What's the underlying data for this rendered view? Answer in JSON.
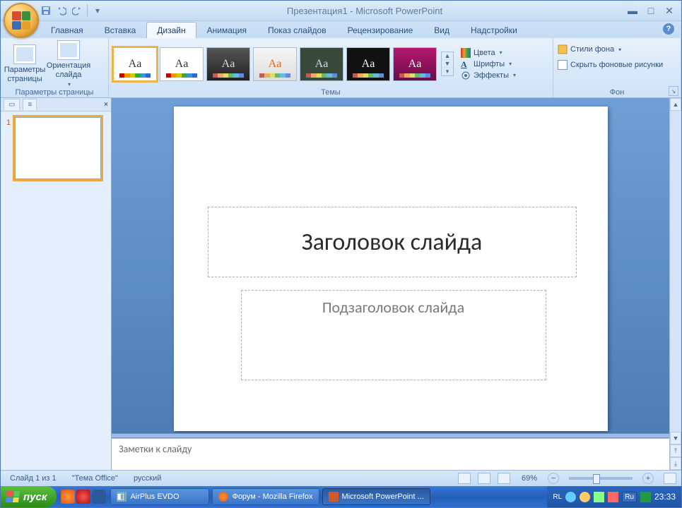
{
  "window": {
    "title": "Презентация1 - Microsoft PowerPoint"
  },
  "tabs": {
    "items": [
      "Главная",
      "Вставка",
      "Дизайн",
      "Анимация",
      "Показ слайдов",
      "Рецензирование",
      "Вид",
      "Надстройки"
    ],
    "active_index": 2
  },
  "ribbon": {
    "page_setup": {
      "page_params": "Параметры\nстраницы",
      "orientation": "Ориентация\nслайда",
      "group": "Параметры страницы"
    },
    "themes": {
      "group": "Темы"
    },
    "style": {
      "colors": "Цвета",
      "fonts": "Шрифты",
      "effects": "Эффекты"
    },
    "background": {
      "styles": "Стили фона",
      "hide": "Скрыть фоновые рисунки",
      "group": "Фон"
    }
  },
  "thumbs": {
    "slide_num": "1"
  },
  "slide": {
    "title": "Заголовок слайда",
    "subtitle": "Подзаголовок слайда"
  },
  "notes": {
    "placeholder": "Заметки к слайду"
  },
  "status": {
    "slide": "Слайд 1 из 1",
    "theme": "\"Тема Office\"",
    "lang": "русский",
    "zoom": "69%"
  },
  "taskbar": {
    "start": "пуск",
    "apps": [
      {
        "label": "AirPlus EVDO"
      },
      {
        "label": "Форум - Mozilla Firefox"
      },
      {
        "label": "Microsoft PowerPoint ..."
      }
    ],
    "lang_ind": "RL",
    "kb": "Ru",
    "clock": "23:33"
  }
}
